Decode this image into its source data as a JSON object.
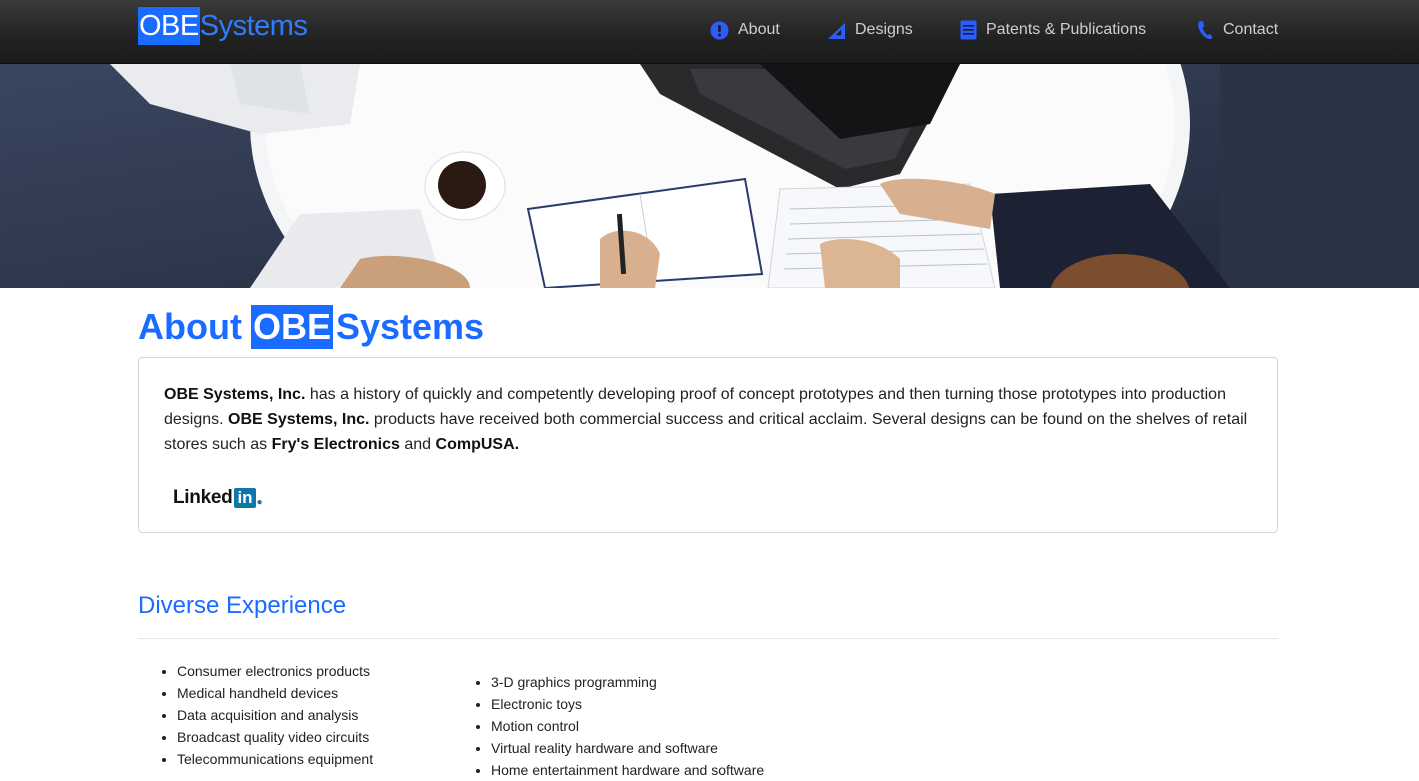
{
  "brand": {
    "obe": "OBE",
    "systems": "Systems"
  },
  "nav": [
    {
      "label": "About",
      "icon": "info-circle-icon"
    },
    {
      "label": "Designs",
      "icon": "triangle-ruler-icon"
    },
    {
      "label": "Patents & Publications",
      "icon": "document-icon"
    },
    {
      "label": "Contact",
      "icon": "phone-icon"
    }
  ],
  "colors": {
    "accent": "#1a6bff",
    "navbar": "#222222"
  },
  "about": {
    "title_prefix": "About",
    "title_obe": "OBE",
    "title_systems": "Systems",
    "company": "OBE Systems, Inc.",
    "text1": " has a history of quickly and competently developing proof of concept prototypes and then turning those prototypes into production designs. ",
    "text2": " products have received both commercial success and critical acclaim. Several designs can be found on the shelves of retail stores such as ",
    "store1": "Fry's Electronics",
    "and": " and ",
    "store2": "CompUSA.",
    "linkedin_text": "Linked",
    "linkedin_in": "in"
  },
  "experience": {
    "title": "Diverse Experience",
    "left": [
      "Consumer electronics products",
      "Medical handheld devices",
      "Data acquisition and analysis",
      "Broadcast quality video circuits",
      "Telecommunications equipment"
    ],
    "right": [
      "3-D graphics programming",
      "Electronic toys",
      "Motion control",
      "Virtual reality hardware and software",
      "Home entertainment hardware and software"
    ]
  }
}
